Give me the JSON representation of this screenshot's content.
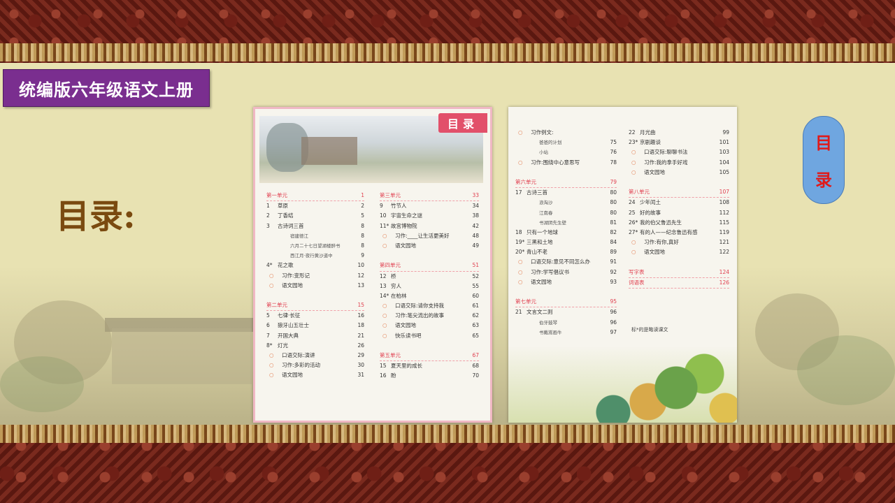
{
  "slide": {
    "badge_title": "统编版六年级语文上册",
    "big_label": "目录:",
    "side_oval": [
      "目",
      "录"
    ]
  },
  "book": {
    "tab_label": "目录",
    "left_col1": [
      {
        "num": "第一单元",
        "title": "",
        "page": "1",
        "type": "unit"
      },
      {
        "num": "1",
        "title": "草原",
        "page": "2",
        "type": "item"
      },
      {
        "num": "2",
        "title": "丁香结",
        "page": "5",
        "type": "item"
      },
      {
        "num": "3",
        "title": "古诗词三首",
        "page": "8",
        "type": "item"
      },
      {
        "num": "",
        "title": "宿建德江",
        "page": "8",
        "type": "sub"
      },
      {
        "num": "",
        "title": "六月二十七日望湖楼醉书",
        "page": "8",
        "type": "sub"
      },
      {
        "num": "",
        "title": "西江月·夜行黄沙道中",
        "page": "9",
        "type": "sub"
      },
      {
        "num": "4*",
        "title": "花之歌",
        "page": "10",
        "type": "item"
      },
      {
        "num": "○",
        "title": "习作:变形记",
        "page": "12",
        "type": "bullet"
      },
      {
        "num": "○",
        "title": "语文园地",
        "page": "13",
        "type": "bullet"
      },
      {
        "num": "",
        "title": "",
        "page": "",
        "type": "gap"
      },
      {
        "num": "第二单元",
        "title": "",
        "page": "15",
        "type": "unit"
      },
      {
        "num": "5",
        "title": "七律·长征",
        "page": "16",
        "type": "item"
      },
      {
        "num": "6",
        "title": "狼牙山五壮士",
        "page": "18",
        "type": "item"
      },
      {
        "num": "7",
        "title": "开国大典",
        "page": "21",
        "type": "item"
      },
      {
        "num": "8*",
        "title": "灯光",
        "page": "26",
        "type": "item"
      },
      {
        "num": "○",
        "title": "口语交际:演讲",
        "page": "29",
        "type": "bullet"
      },
      {
        "num": "○",
        "title": "习作:多彩的活动",
        "page": "30",
        "type": "bullet"
      },
      {
        "num": "○",
        "title": "语文园地",
        "page": "31",
        "type": "bullet"
      }
    ],
    "left_col2": [
      {
        "num": "第三单元",
        "title": "",
        "page": "33",
        "type": "unit"
      },
      {
        "num": "9",
        "title": "竹节人",
        "page": "34",
        "type": "item"
      },
      {
        "num": "10",
        "title": "宇宙生命之谜",
        "page": "38",
        "type": "item"
      },
      {
        "num": "11*",
        "title": "故宫博物院",
        "page": "42",
        "type": "item"
      },
      {
        "num": "○",
        "title": "习作:____让生活更美好",
        "page": "48",
        "type": "bullet"
      },
      {
        "num": "○",
        "title": "语文园地",
        "page": "49",
        "type": "bullet"
      },
      {
        "num": "",
        "title": "",
        "page": "",
        "type": "gap"
      },
      {
        "num": "第四单元",
        "title": "",
        "page": "51",
        "type": "unit"
      },
      {
        "num": "12",
        "title": "桥",
        "page": "52",
        "type": "item"
      },
      {
        "num": "13",
        "title": "穷人",
        "page": "55",
        "type": "item"
      },
      {
        "num": "14*",
        "title": "在柏林",
        "page": "60",
        "type": "item"
      },
      {
        "num": "○",
        "title": "口语交际:请你支持我",
        "page": "61",
        "type": "bullet"
      },
      {
        "num": "○",
        "title": "习作:笔尖流出的故事",
        "page": "62",
        "type": "bullet"
      },
      {
        "num": "○",
        "title": "语文园地",
        "page": "63",
        "type": "bullet"
      },
      {
        "num": "○",
        "title": "快乐读书吧",
        "page": "65",
        "type": "bullet"
      },
      {
        "num": "",
        "title": "",
        "page": "",
        "type": "gap"
      },
      {
        "num": "第五单元",
        "title": "",
        "page": "67",
        "type": "unit"
      },
      {
        "num": "15",
        "title": "夏天里的成长",
        "page": "68",
        "type": "item"
      },
      {
        "num": "16",
        "title": "盼",
        "page": "70",
        "type": "item"
      }
    ],
    "right_col1": [
      {
        "num": "○",
        "title": "习作例文:",
        "page": "",
        "type": "bullet"
      },
      {
        "num": "",
        "title": "爸爸的计划",
        "page": "75",
        "type": "sub"
      },
      {
        "num": "",
        "title": "小站",
        "page": "76",
        "type": "sub"
      },
      {
        "num": "○",
        "title": "习作:围绕中心意思写",
        "page": "78",
        "type": "bullet"
      },
      {
        "num": "",
        "title": "",
        "page": "",
        "type": "gap"
      },
      {
        "num": "第六单元",
        "title": "",
        "page": "79",
        "type": "unit"
      },
      {
        "num": "17",
        "title": "古诗三首",
        "page": "80",
        "type": "item"
      },
      {
        "num": "",
        "title": "浪淘沙",
        "page": "80",
        "type": "sub"
      },
      {
        "num": "",
        "title": "江南春",
        "page": "80",
        "type": "sub"
      },
      {
        "num": "",
        "title": "书湖阴先生壁",
        "page": "81",
        "type": "sub"
      },
      {
        "num": "18",
        "title": "只有一个地球",
        "page": "82",
        "type": "item"
      },
      {
        "num": "19*",
        "title": "三黑和土地",
        "page": "84",
        "type": "item"
      },
      {
        "num": "20*",
        "title": "青山不老",
        "page": "89",
        "type": "item"
      },
      {
        "num": "○",
        "title": "口语交际:意见不同怎么办",
        "page": "91",
        "type": "bullet"
      },
      {
        "num": "○",
        "title": "习作:学写倡议书",
        "page": "92",
        "type": "bullet"
      },
      {
        "num": "○",
        "title": "语文园地",
        "page": "93",
        "type": "bullet"
      },
      {
        "num": "",
        "title": "",
        "page": "",
        "type": "gap"
      },
      {
        "num": "第七单元",
        "title": "",
        "page": "95",
        "type": "unit"
      },
      {
        "num": "21",
        "title": "文言文二则",
        "page": "96",
        "type": "item"
      },
      {
        "num": "",
        "title": "伯牙鼓琴",
        "page": "96",
        "type": "sub"
      },
      {
        "num": "",
        "title": "书戴嵩画牛",
        "page": "97",
        "type": "sub"
      }
    ],
    "right_col2": [
      {
        "num": "22",
        "title": "月光曲",
        "page": "99",
        "type": "item"
      },
      {
        "num": "23*",
        "title": "京剧趣谈",
        "page": "101",
        "type": "item"
      },
      {
        "num": "○",
        "title": "口语交际:聊聊书法",
        "page": "103",
        "type": "bullet"
      },
      {
        "num": "○",
        "title": "习作:我的拿手好戏",
        "page": "104",
        "type": "bullet"
      },
      {
        "num": "○",
        "title": "语文园地",
        "page": "105",
        "type": "bullet"
      },
      {
        "num": "",
        "title": "",
        "page": "",
        "type": "gap"
      },
      {
        "num": "第八单元",
        "title": "",
        "page": "107",
        "type": "unit"
      },
      {
        "num": "24",
        "title": "少年闰土",
        "page": "108",
        "type": "item"
      },
      {
        "num": "25",
        "title": "好的故事",
        "page": "112",
        "type": "item"
      },
      {
        "num": "26*",
        "title": "我的伯父鲁迅先生",
        "page": "115",
        "type": "item"
      },
      {
        "num": "27*",
        "title": "有的人——纪念鲁迅有感",
        "page": "119",
        "type": "item"
      },
      {
        "num": "○",
        "title": "习作:有你,真好",
        "page": "121",
        "type": "bullet"
      },
      {
        "num": "○",
        "title": "语文园地",
        "page": "122",
        "type": "bullet"
      },
      {
        "num": "",
        "title": "",
        "page": "",
        "type": "gap"
      },
      {
        "num": "写字表",
        "title": "",
        "page": "124",
        "type": "unit"
      },
      {
        "num": "词语表",
        "title": "",
        "page": "126",
        "type": "unit"
      }
    ],
    "note": "标*的是略读课文"
  }
}
